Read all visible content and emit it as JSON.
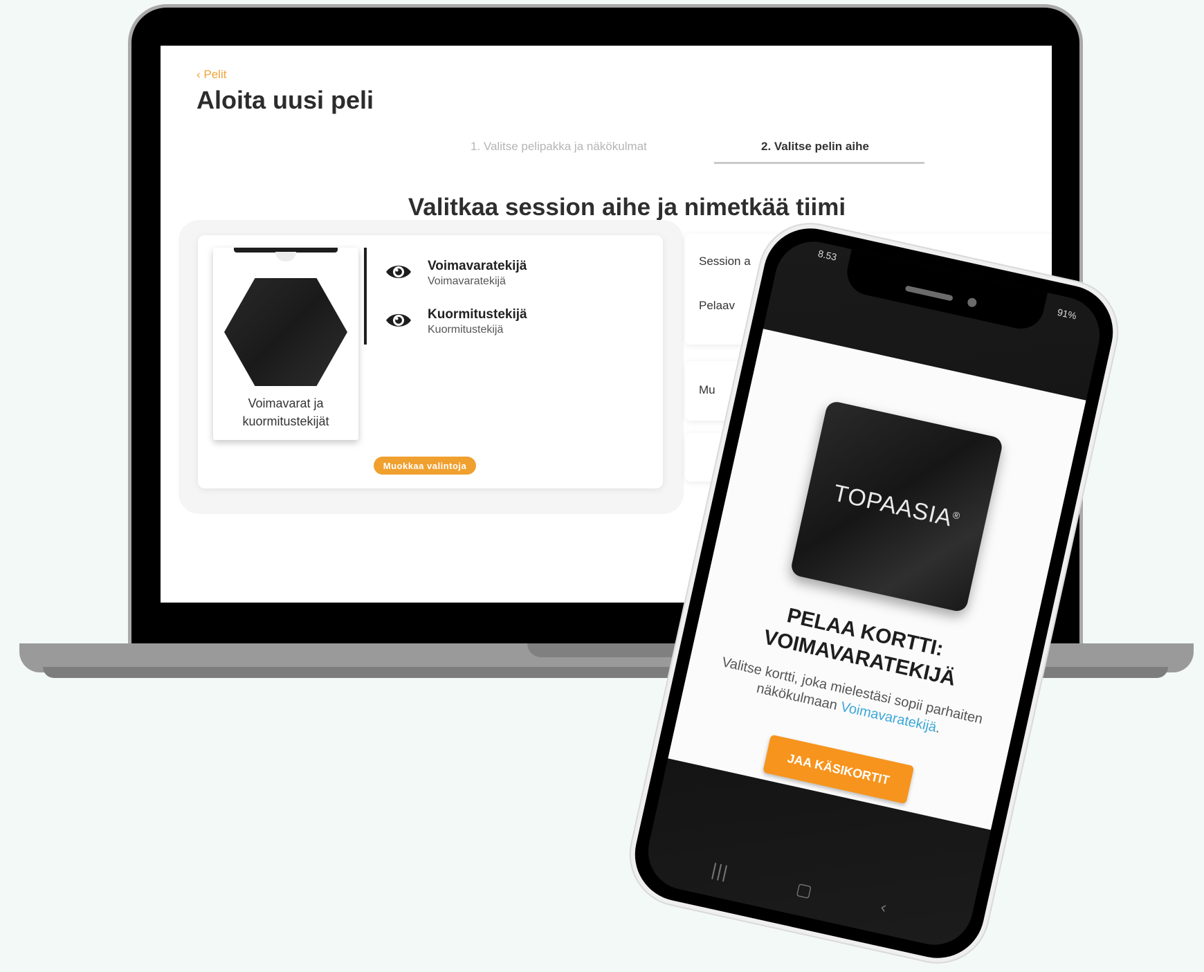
{
  "laptop": {
    "back_label": "Pelit",
    "page_title": "Aloita uusi peli",
    "steps": [
      {
        "label": "1. Valitse pelipakka ja näkökulmat",
        "active": false
      },
      {
        "label": "2. Valitse pelin aihe",
        "active": true
      }
    ],
    "section_heading": "Valitkaa session aihe ja nimetkää tiimi",
    "deck": {
      "name": "Voimavarat ja kuormitustekijät"
    },
    "perspectives": [
      {
        "title": "Voimavaratekijä",
        "subtitle": "Voimavaratekijä",
        "icon": "eye-icon"
      },
      {
        "title": "Kuormitustekijä",
        "subtitle": "Kuormitustekijä",
        "icon": "eye-icon"
      }
    ],
    "edit_button": "Muokkaa valintoja",
    "side_labels": [
      "Session a",
      "Pelaav",
      "Mu"
    ]
  },
  "phone": {
    "status_time": "8.53",
    "status_battery": "91%",
    "card_brand": "TOPAASIA",
    "card_brand_mark": "®",
    "title_line1": "PELAA KORTTI:",
    "title_line2": "VOIMAVARATEKIJÄ",
    "desc_text": "Valitse kortti, joka mielestäsi sopii parhaiten näkökulmaan",
    "desc_highlight": "Voimavaratekijä",
    "desc_end": ".",
    "button_label": "JAA KÄSIKORTIT",
    "nav": {
      "recent": "|||",
      "home": "▢",
      "back": "‹"
    }
  },
  "colors": {
    "accent_orange": "#f0a02e",
    "phone_button": "#f7941d",
    "link_blue": "#3ba7d8",
    "background": "#f3f9f6"
  }
}
